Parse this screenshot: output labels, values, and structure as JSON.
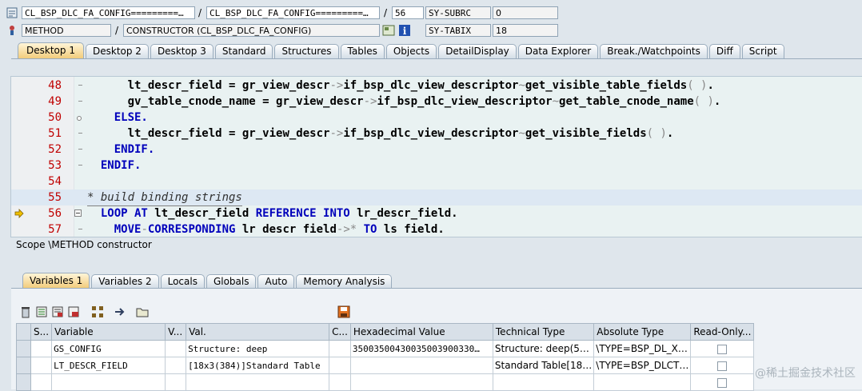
{
  "header": {
    "program": "CL_BSP_DLC_FA_CONFIG=========…",
    "include": "CL_BSP_DLC_FA_CONFIG=========…",
    "slash": "/",
    "line": "56",
    "sysvar1_name": "SY-SUBRC",
    "sysvar1_value": "0",
    "event_type": "METHOD",
    "event": "CONSTRUCTOR (CL_BSP_DLC_FA_CONFIG)",
    "sysvar2_name": "SY-TABIX",
    "sysvar2_value": "18"
  },
  "desktop_tabs": [
    "Desktop 1",
    "Desktop 2",
    "Desktop 3",
    "Standard",
    "Structures",
    "Tables",
    "Objects",
    "DetailDisplay",
    "Data Explorer",
    "Break./Watchpoints",
    "Diff",
    "Script"
  ],
  "code_lines": [
    {
      "num": "48",
      "indent": "      ",
      "segments": [
        {
          "t": "lt_descr_field = gr_view_descr",
          "c": ""
        },
        {
          "t": "->",
          "c": "pun"
        },
        {
          "t": "if_bsp_dlc_view_descriptor",
          "c": ""
        },
        {
          "t": "~",
          "c": "pun"
        },
        {
          "t": "get_visible_table_fields",
          "c": ""
        },
        {
          "t": "( )",
          "c": "pun"
        },
        {
          "t": ".",
          "c": ""
        }
      ]
    },
    {
      "num": "49",
      "indent": "      ",
      "segments": [
        {
          "t": "gv_table_cnode_name = gr_view_descr",
          "c": ""
        },
        {
          "t": "->",
          "c": "pun"
        },
        {
          "t": "if_bsp_dlc_view_descriptor",
          "c": ""
        },
        {
          "t": "~",
          "c": "pun"
        },
        {
          "t": "get_table_cnode_name",
          "c": ""
        },
        {
          "t": "( )",
          "c": "pun"
        },
        {
          "t": ".",
          "c": ""
        }
      ]
    },
    {
      "num": "50",
      "indent": "    ",
      "segments": [
        {
          "t": "ELSE.",
          "c": "kw"
        }
      ]
    },
    {
      "num": "51",
      "indent": "      ",
      "segments": [
        {
          "t": "lt_descr_field = gr_view_descr",
          "c": ""
        },
        {
          "t": "->",
          "c": "pun"
        },
        {
          "t": "if_bsp_dlc_view_descriptor",
          "c": ""
        },
        {
          "t": "~",
          "c": "pun"
        },
        {
          "t": "get_visible_fields",
          "c": ""
        },
        {
          "t": "( )",
          "c": "pun"
        },
        {
          "t": ".",
          "c": ""
        }
      ]
    },
    {
      "num": "52",
      "indent": "    ",
      "segments": [
        {
          "t": "ENDIF.",
          "c": "kw"
        }
      ]
    },
    {
      "num": "53",
      "indent": "  ",
      "segments": [
        {
          "t": "ENDIF.",
          "c": "kw"
        }
      ]
    },
    {
      "num": "54",
      "indent": "",
      "segments": []
    },
    {
      "num": "55",
      "indent": "",
      "segments": [
        {
          "t": "* build binding strings",
          "c": "cm"
        }
      ]
    },
    {
      "num": "56",
      "indent": "  ",
      "segments": [
        {
          "t": "LOOP AT",
          "c": "kw"
        },
        {
          "t": " lt_descr_field ",
          "c": ""
        },
        {
          "t": "REFERENCE INTO",
          "c": "kw"
        },
        {
          "t": " lr_descr_field.",
          "c": ""
        }
      ]
    },
    {
      "num": "57",
      "indent": "    ",
      "segments": [
        {
          "t": "MOVE",
          "c": "kw"
        },
        {
          "t": "-",
          "c": "pun"
        },
        {
          "t": "CORRESPONDING",
          "c": "kw"
        },
        {
          "t": " lr descr field",
          "c": ""
        },
        {
          "t": "->*",
          "c": "pun"
        },
        {
          "t": " TO",
          "c": "kw"
        },
        {
          "t": " ls field.",
          "c": ""
        }
      ]
    }
  ],
  "scope": "Scope \\METHOD constructor",
  "var_tabs": [
    "Variables 1",
    "Variables 2",
    "Locals",
    "Globals",
    "Auto",
    "Memory Analysis"
  ],
  "grid": {
    "headers": [
      "S...",
      "Variable",
      "V...",
      "Val.",
      "C...",
      "Hexadecimal Value",
      "Technical Type",
      "Absolute Type",
      "Read-Only..."
    ],
    "rows": [
      [
        "",
        "GS_CONFIG",
        "",
        "Structure: deep",
        "",
        "35003500430035003900330…",
        "Structure: deep(5…",
        "\\TYPE=BSP_DL_X…",
        ""
      ],
      [
        "",
        "LT_DESCR_FIELD",
        "",
        "[18x3(384)]Standard Table",
        "",
        "",
        "Standard Table[18…",
        "\\TYPE=BSP_DLCT…",
        ""
      ],
      [
        "",
        "",
        "",
        "",
        "",
        "",
        "",
        "",
        ""
      ]
    ]
  },
  "watermark": "@稀土掘金技术社区",
  "colors": {
    "accent": "#f2cc7c",
    "keyword": "#0000bb",
    "line_number": "#c00000"
  }
}
